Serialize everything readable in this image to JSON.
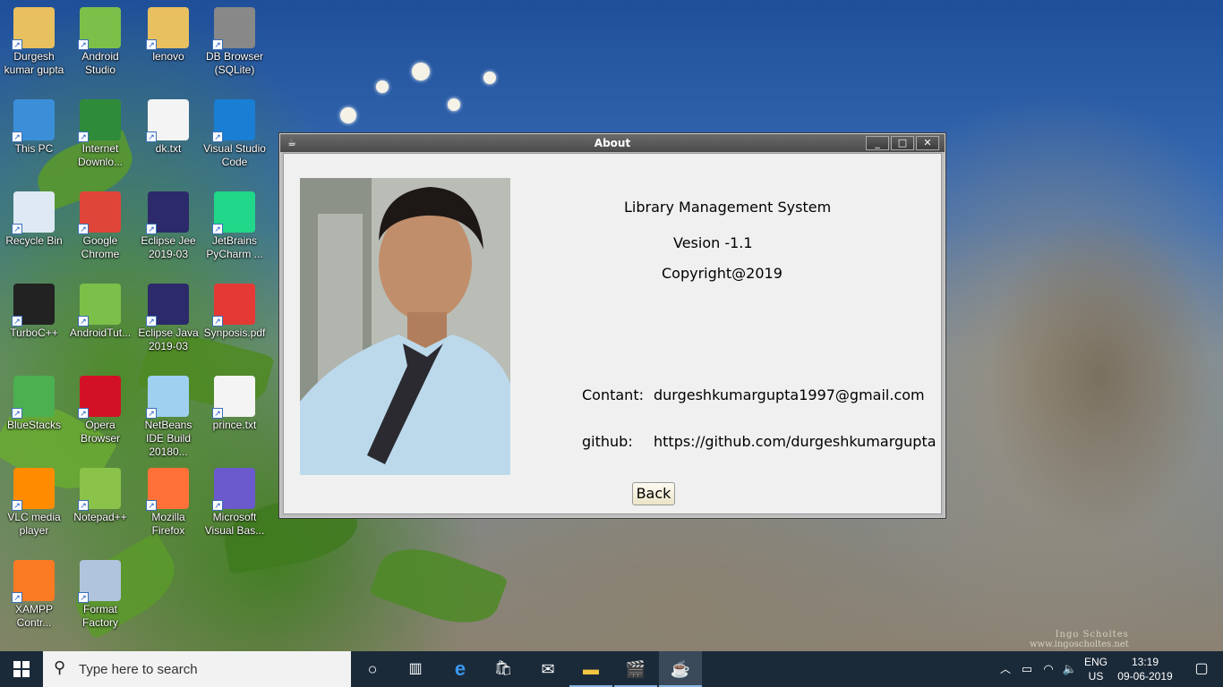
{
  "desktop": {
    "icons": [
      {
        "label": "Durgesh kumar gupta",
        "icon": "user-folder-icon",
        "color": "#e8c060"
      },
      {
        "label": "Android Studio",
        "icon": "android-studio-icon",
        "color": "#7cc04a"
      },
      {
        "label": "lenovo",
        "icon": "pdf-folder-icon",
        "color": "#e8c060"
      },
      {
        "label": "DB Browser (SQLite)",
        "icon": "database-icon",
        "color": "#888888"
      },
      {
        "label": "This PC",
        "icon": "computer-icon",
        "color": "#3a8fd8"
      },
      {
        "label": "Internet Downlo...",
        "icon": "idm-icon",
        "color": "#2e8b3a"
      },
      {
        "label": "dk.txt",
        "icon": "text-file-icon",
        "color": "#f4f4f4"
      },
      {
        "label": "Visual Studio Code",
        "icon": "vscode-icon",
        "color": "#1a7fd4"
      },
      {
        "label": "Recycle Bin",
        "icon": "recycle-bin-icon",
        "color": "#dfe9f4"
      },
      {
        "label": "Google Chrome",
        "icon": "chrome-icon",
        "color": "#e0453a"
      },
      {
        "label": "Eclipse Jee 2019-03",
        "icon": "eclipse-icon",
        "color": "#2c2a6a"
      },
      {
        "label": "JetBrains PyCharm ...",
        "icon": "pycharm-icon",
        "color": "#21d789"
      },
      {
        "label": "TurboC++",
        "icon": "turboc-icon",
        "color": "#222222"
      },
      {
        "label": "AndroidTut...",
        "icon": "android-studio-icon",
        "color": "#7cc04a"
      },
      {
        "label": "Eclipse Java 2019-03",
        "icon": "eclipse-icon",
        "color": "#2c2a6a"
      },
      {
        "label": "Synposis.pdf",
        "icon": "pdf-file-icon",
        "color": "#e53935"
      },
      {
        "label": "BlueStacks",
        "icon": "bluestacks-icon",
        "color": "#4caf50"
      },
      {
        "label": "Opera Browser",
        "icon": "opera-icon",
        "color": "#d31124"
      },
      {
        "label": "NetBeans IDE Build 20180...",
        "icon": "netbeans-icon",
        "color": "#9fd0f0"
      },
      {
        "label": "prince.txt",
        "icon": "text-file-icon",
        "color": "#f4f4f4"
      },
      {
        "label": "VLC media player",
        "icon": "vlc-icon",
        "color": "#ff8c00"
      },
      {
        "label": "Notepad++",
        "icon": "notepadpp-icon",
        "color": "#8bc34a"
      },
      {
        "label": "Mozilla Firefox",
        "icon": "firefox-icon",
        "color": "#ff7139"
      },
      {
        "label": "Microsoft Visual Bas...",
        "icon": "visual-basic-icon",
        "color": "#6a5acd"
      },
      {
        "label": "XAMPP Contr...",
        "icon": "xampp-icon",
        "color": "#fb7a24"
      },
      {
        "label": "Format Factory",
        "icon": "format-factory-icon",
        "color": "#b0c4de"
      }
    ],
    "watermark_line1": "Ingo Scholtes",
    "watermark_line2": "www.ingoscholtes.net"
  },
  "window": {
    "title": "About",
    "app_icon": "java-cup-icon",
    "minimize_glyph": "_",
    "maximize_glyph": "□",
    "close_glyph": "✕",
    "app_name": "Library Management System",
    "version": "Vesion -1.1",
    "copyright": "Copyright@2019",
    "contact_label": "Contant:",
    "contact_value": "durgeshkumargupta1997@gmail.com",
    "github_label": "github:",
    "github_value": "https://github.com/durgeshkumargupta",
    "back_label": "Back"
  },
  "taskbar": {
    "search_placeholder": "Type here to search",
    "apps": [
      "task-view-icon",
      "edge-icon",
      "store-icon",
      "mail-icon",
      "file-explorer-icon",
      "clapper-icon",
      "java-icon"
    ],
    "lang_top": "ENG",
    "lang_bottom": "US",
    "time": "13:19",
    "date": "09-06-2019",
    "accent": "#1b2a39"
  }
}
